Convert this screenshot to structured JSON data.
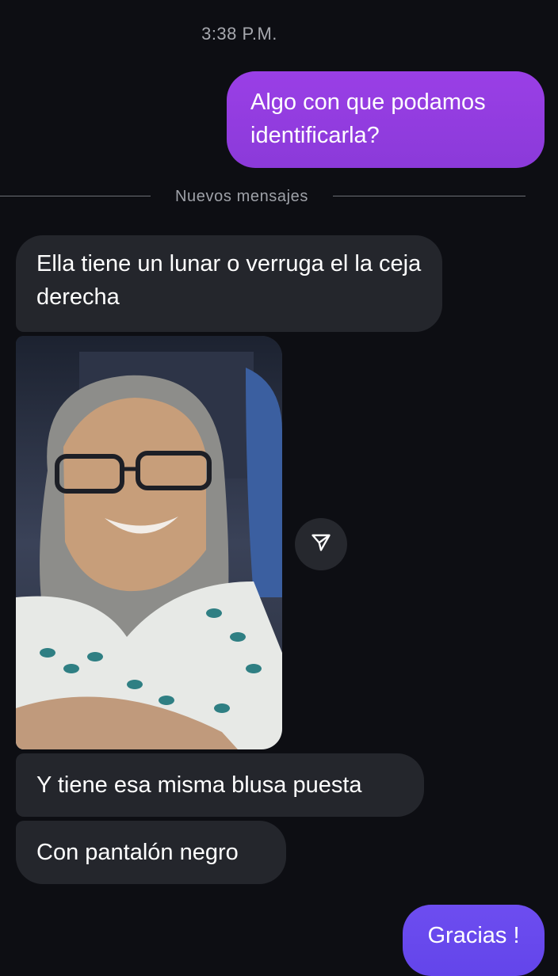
{
  "header": {
    "timestamp": "3:38 P.M."
  },
  "messages": {
    "outgoing_1": "Algo con que podamos identificarla?",
    "divider_label": "Nuevos mensajes",
    "incoming_1": "Ella tiene un lunar o verruga el la ceja derecha",
    "incoming_2": "Y tiene esa misma blusa puesta",
    "incoming_3": "Con pantalón negro",
    "outgoing_2": "Gracias !"
  },
  "icons": {
    "share": "share-icon"
  },
  "colors": {
    "background": "#0d0e13",
    "outgoing_bubble": "#8b3ad9",
    "outgoing_bubble_last": "#6345ea",
    "incoming_bubble": "#24262c"
  }
}
